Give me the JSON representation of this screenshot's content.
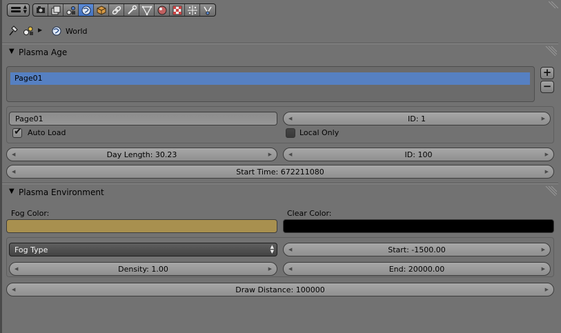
{
  "header": {
    "editor_type_icon": "properties-editor-icon",
    "context_tabs": [
      {
        "name": "render-icon",
        "active": false
      },
      {
        "name": "render-layers-icon",
        "active": false
      },
      {
        "name": "scene-icon",
        "active": false
      },
      {
        "name": "world-icon",
        "active": true
      },
      {
        "name": "object-icon",
        "active": false
      },
      {
        "name": "constraints-icon",
        "active": false
      },
      {
        "name": "modifiers-icon",
        "active": false
      },
      {
        "name": "data-icon",
        "active": false
      },
      {
        "name": "material-icon",
        "active": false
      },
      {
        "name": "texture-icon",
        "active": false
      },
      {
        "name": "particles-icon",
        "active": false
      },
      {
        "name": "physics-icon",
        "active": false
      }
    ]
  },
  "breadcrumb": {
    "label": "World"
  },
  "plasma_age": {
    "title": "Plasma Age",
    "pages": [
      "Page01"
    ],
    "page_name": "Page01",
    "page_id": "ID: 1",
    "auto_load_label": "Auto Load",
    "auto_load": true,
    "local_only_label": "Local Only",
    "local_only": false,
    "day_length": "Day Length: 30.23",
    "age_id": "ID: 100",
    "start_time": "Start Time: 672211080"
  },
  "plasma_environment": {
    "title": "Plasma Environment",
    "fog_color_label": "Fog Color:",
    "fog_color": "#a8904f",
    "clear_color_label": "Clear Color:",
    "clear_color": "#000000",
    "fog_type": "Fog Type",
    "start": "Start: -1500.00",
    "density": "Density: 1.00",
    "end": "End: 20000.00",
    "draw_distance": "Draw Distance: 100000"
  },
  "colors": {
    "background": "#727272",
    "selection": "#5680c2",
    "active_tab": "#5680c2"
  }
}
